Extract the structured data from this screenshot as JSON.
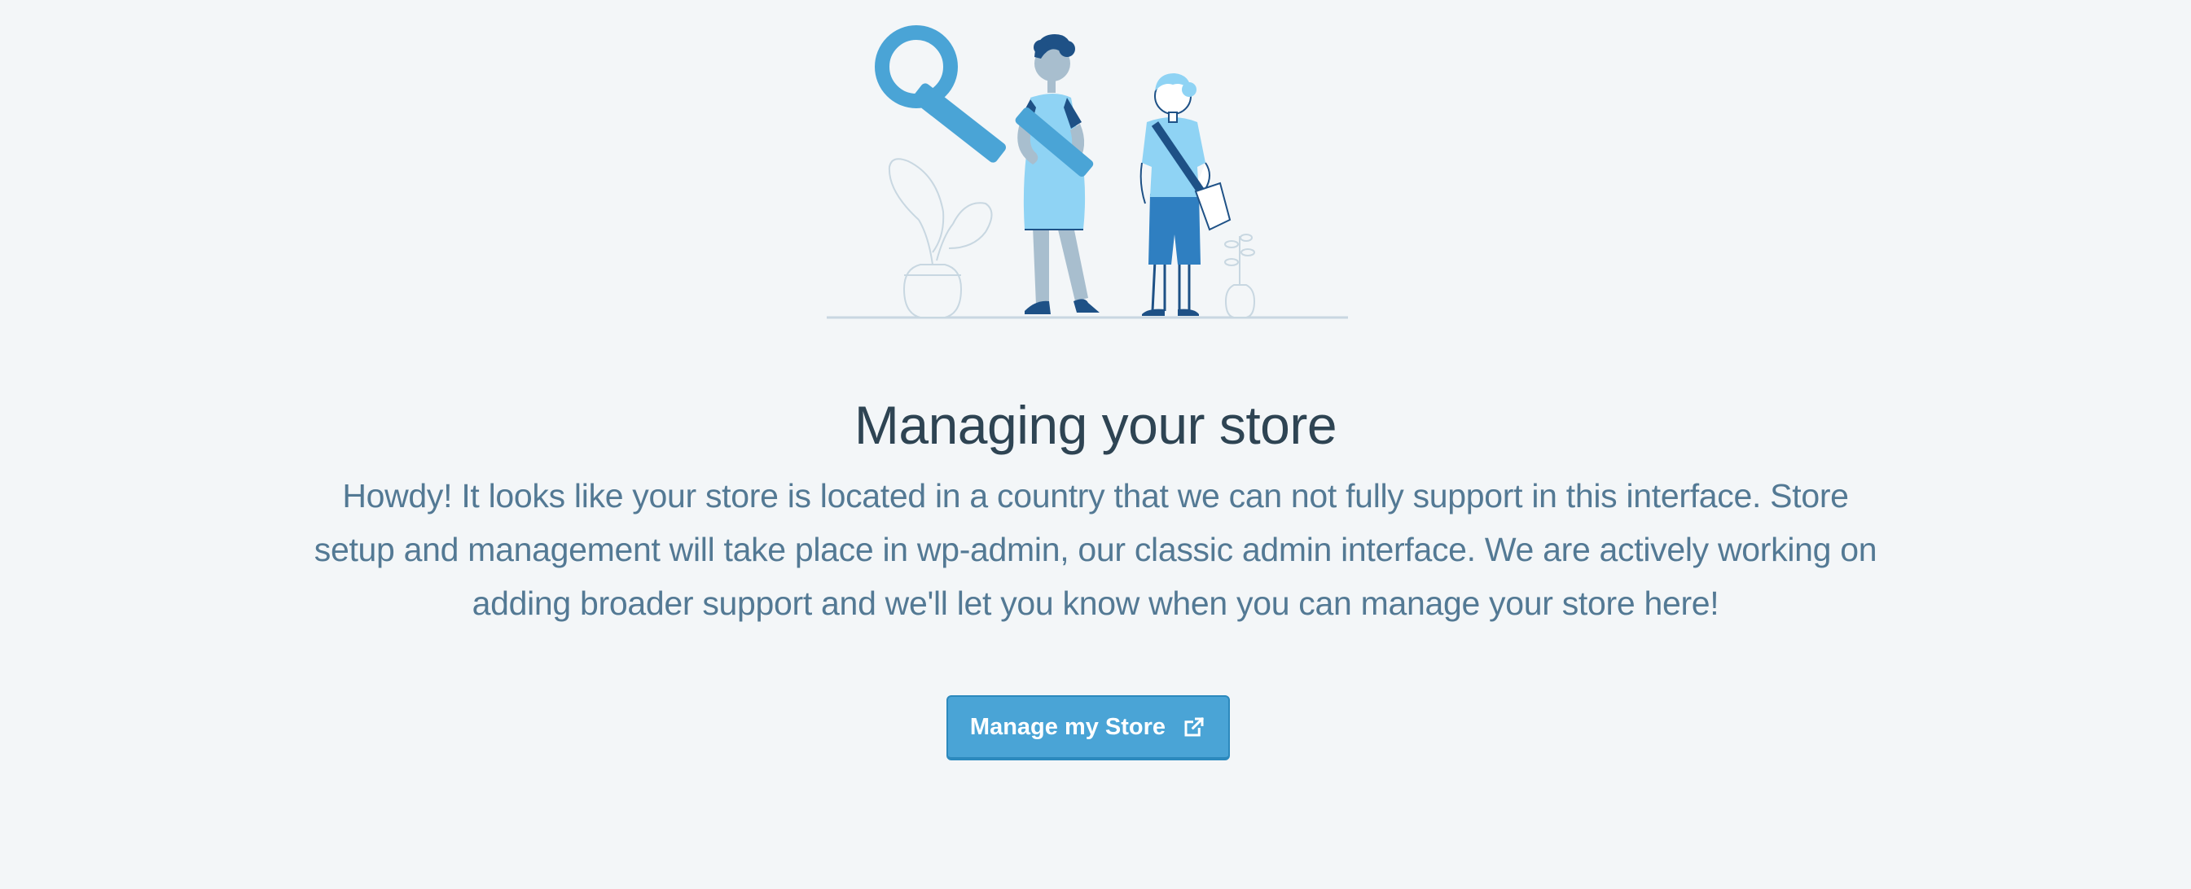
{
  "main": {
    "title": "Managing your store",
    "description": "Howdy! It looks like your store is located in a country that we can not fully support in this interface. Store setup and management will take place in wp-admin, our classic admin interface. We are actively working on adding broader support and we'll let you know when you can manage your store here!",
    "button": {
      "label": "Manage my Store",
      "icon": "external-link-icon"
    }
  },
  "colors": {
    "background": "#f3f6f8",
    "title": "#2e4453",
    "text": "#537994",
    "button": "#4aa4d6",
    "button_border": "#2c89bd"
  }
}
